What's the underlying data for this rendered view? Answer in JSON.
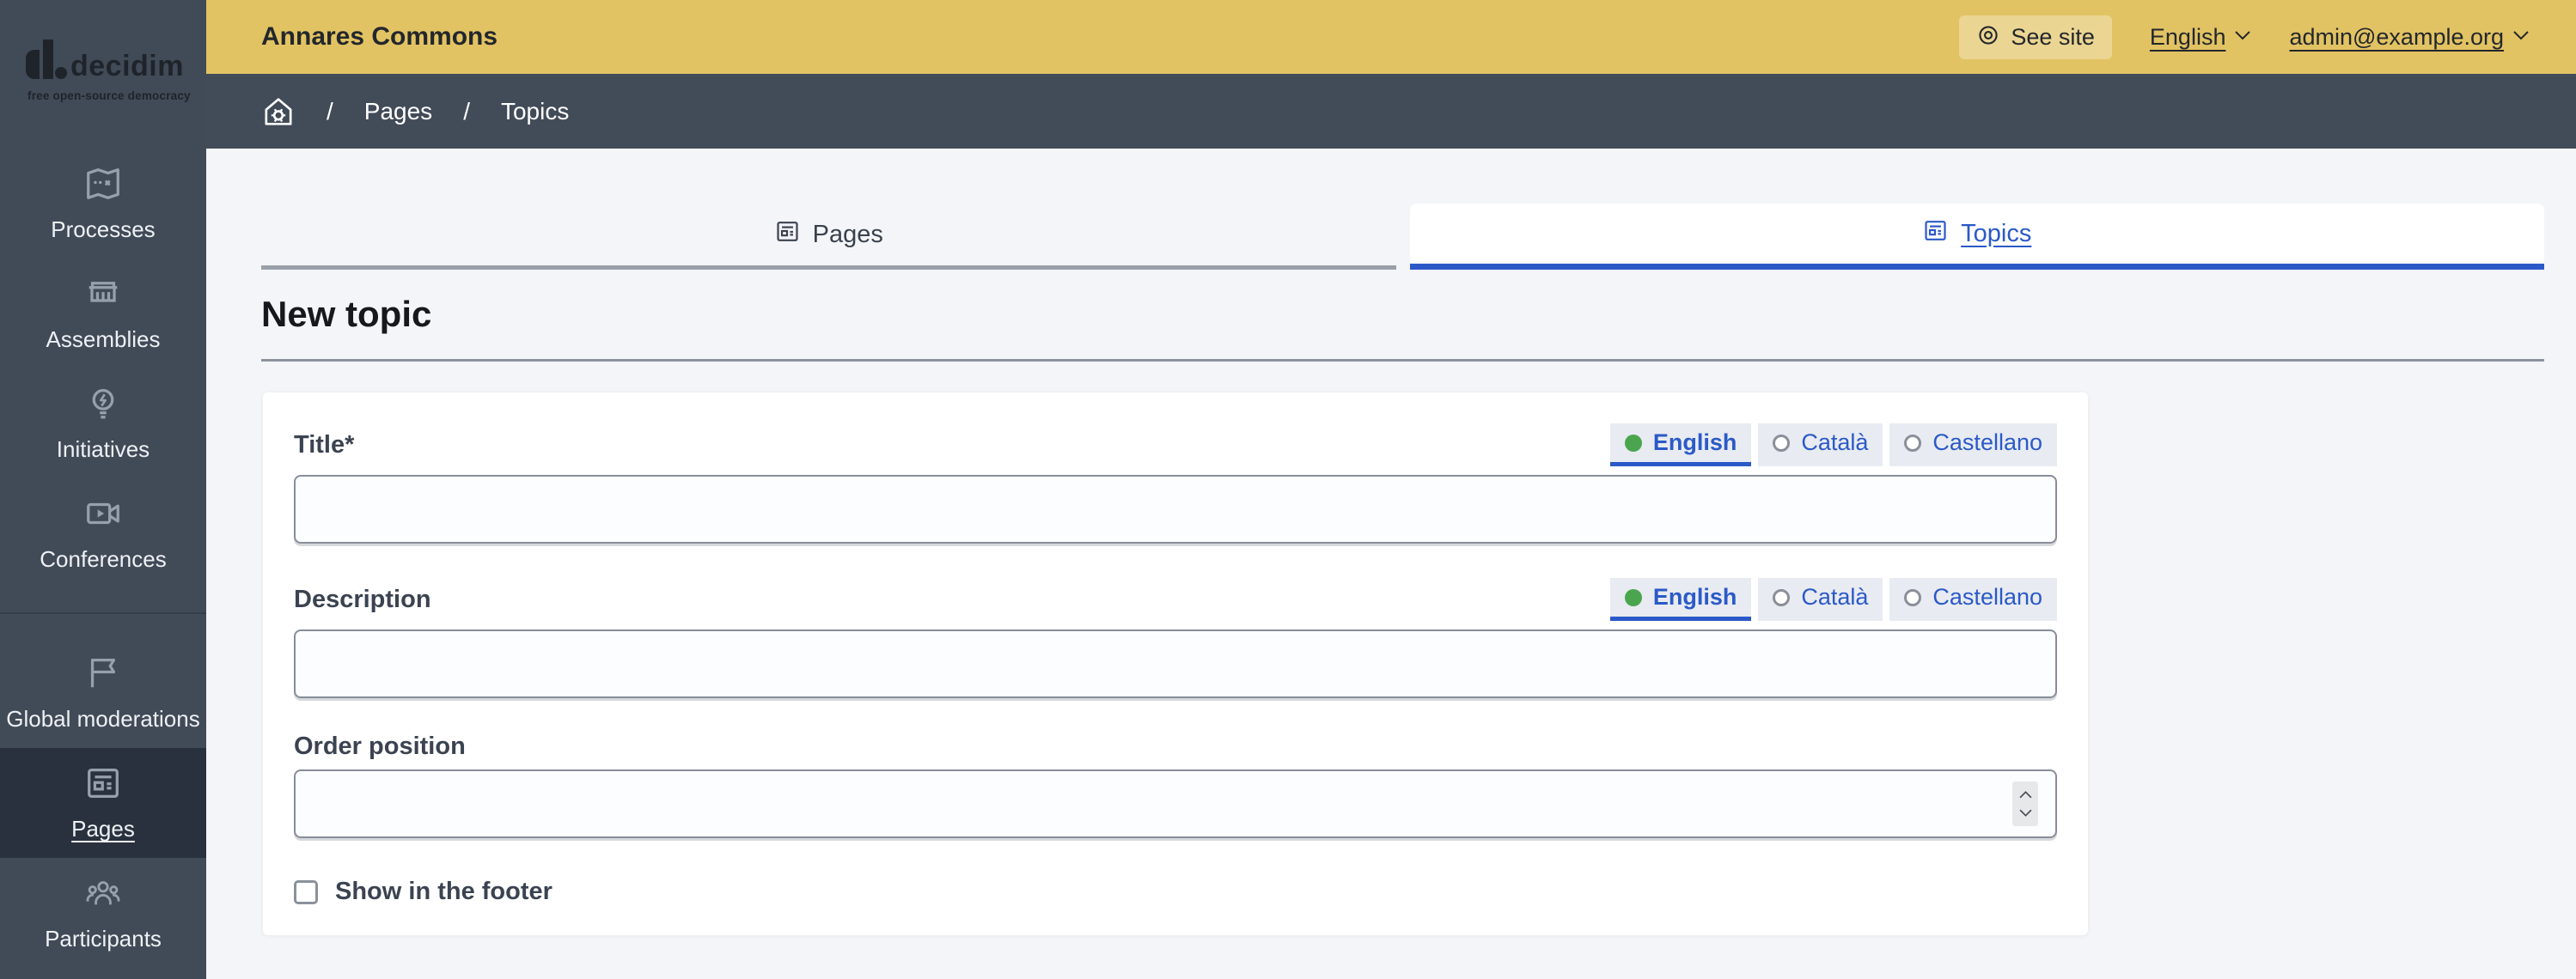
{
  "brand": {
    "name": "decidim",
    "tagline": "free open-source democracy"
  },
  "header": {
    "title": "Annares Commons",
    "see_site_label": "See site",
    "language_selected": "English",
    "user_email": "admin@example.org"
  },
  "breadcrumb": {
    "separator": "/",
    "items": [
      "Pages",
      "Topics"
    ]
  },
  "sidebar": {
    "groups": [
      {
        "items": [
          {
            "label": "Processes",
            "icon": "map-icon"
          },
          {
            "label": "Assemblies",
            "icon": "bank-icon"
          },
          {
            "label": "Initiatives",
            "icon": "lightbulb-flash-icon"
          },
          {
            "label": "Conferences",
            "icon": "video-camera-icon"
          }
        ]
      },
      {
        "items": [
          {
            "label": "Global moderations",
            "icon": "flag-icon"
          },
          {
            "label": "Pages",
            "icon": "article-icon",
            "active": true
          },
          {
            "label": "Participants",
            "icon": "team-icon"
          }
        ]
      }
    ]
  },
  "tabs": [
    {
      "label": "Pages",
      "icon": "article-icon",
      "active": false
    },
    {
      "label": "Topics",
      "icon": "article-icon",
      "active": true
    }
  ],
  "page": {
    "heading": "New topic"
  },
  "form": {
    "languages": [
      "English",
      "Català",
      "Castellano"
    ],
    "selected_language": "English",
    "title": {
      "label": "Title*",
      "value": ""
    },
    "description": {
      "label": "Description",
      "value": ""
    },
    "order": {
      "label": "Order position",
      "value": ""
    },
    "footer_checkbox": {
      "label": "Show in the footer",
      "checked": false
    }
  },
  "colors": {
    "header_yellow": "#e2c363",
    "sidebar_dark": "#414a57",
    "sidebar_active_dark": "#2a313e",
    "link_blue": "#2b59c8",
    "radio_green": "#4aa54e",
    "content_bg": "#f4f5f8",
    "tab_inactive_border": "#9aa0a9"
  }
}
